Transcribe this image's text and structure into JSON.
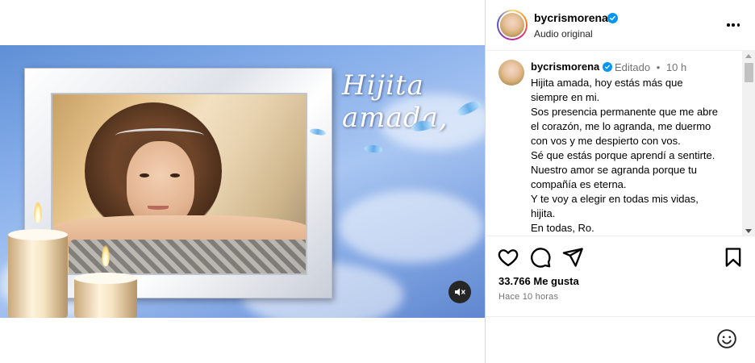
{
  "post": {
    "username": "bycrismorena",
    "audio_label": "Audio original",
    "more_icon": "more-horizontal-icon"
  },
  "media": {
    "overlay_text": "Hijita amada,",
    "mute_icon": "muted-speaker-icon"
  },
  "caption": {
    "username": "bycrismorena",
    "edited_label": "Editado",
    "separator": "•",
    "age": "10 h",
    "lines": [
      "Hijita amada, hoy estás más que",
      "siempre en mi.",
      "Sos presencia permanente que me abre",
      "el corazón, me lo agranda, me duermo",
      "con vos y me despierto con vos.",
      "Sé que estás porque aprendí a sentirte.",
      "Nuestro amor se agranda porque tu",
      "compañía es eterna.",
      "Y te voy a elegir en todas mis vidas,",
      "hijita.",
      "En todas, Ro."
    ]
  },
  "actions": {
    "like_icon": "heart-icon",
    "comment_icon": "comment-icon",
    "share_icon": "share-icon",
    "save_icon": "bookmark-icon"
  },
  "stats": {
    "likes": "33.766 Me gusta",
    "posted": "Hace 10 horas"
  },
  "comment": {
    "emoji_icon": "emoji-icon"
  },
  "colors": {
    "verified": "#0095f6",
    "secondary_text": "#737373",
    "divider": "#dbdbdb"
  }
}
